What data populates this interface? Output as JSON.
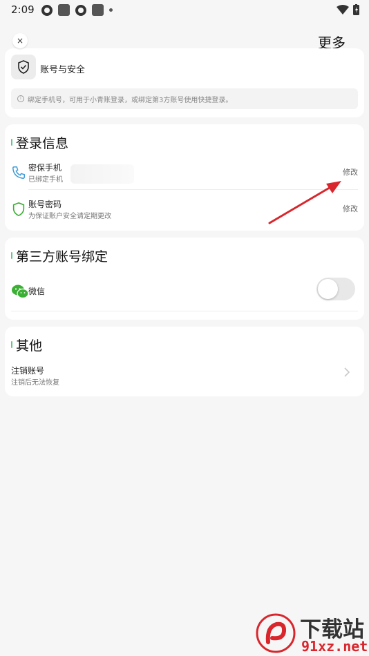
{
  "status_bar": {
    "time": "2:09"
  },
  "header": {
    "close_icon": "×",
    "more_label": "更多"
  },
  "account_card": {
    "title": "账号与安全",
    "hint": "绑定手机号，可用于小青账登录，或绑定第3方账号使用快捷登录。",
    "info_icon": "i"
  },
  "login_section": {
    "title": "登录信息",
    "rows": [
      {
        "title": "密保手机",
        "subtitle": "已绑定手机",
        "action": "修改"
      },
      {
        "title": "账号密码",
        "subtitle": "为保证账户安全请定期更改",
        "action": "修改"
      }
    ]
  },
  "third_party_section": {
    "title": "第三方账号绑定",
    "items": [
      {
        "title": "微信",
        "toggle_on": false
      }
    ]
  },
  "other_section": {
    "title": "其他",
    "items": [
      {
        "title": "注销账号",
        "subtitle": "注销后无法恢复"
      }
    ]
  },
  "watermark": {
    "text_top": "下载站",
    "text_bottom": "91xz.net"
  },
  "colors": {
    "accent_green": "#66c68a",
    "arrow_red": "#d9262c",
    "phone_blue": "#3b9ad9",
    "wechat_green": "#3cb034"
  }
}
